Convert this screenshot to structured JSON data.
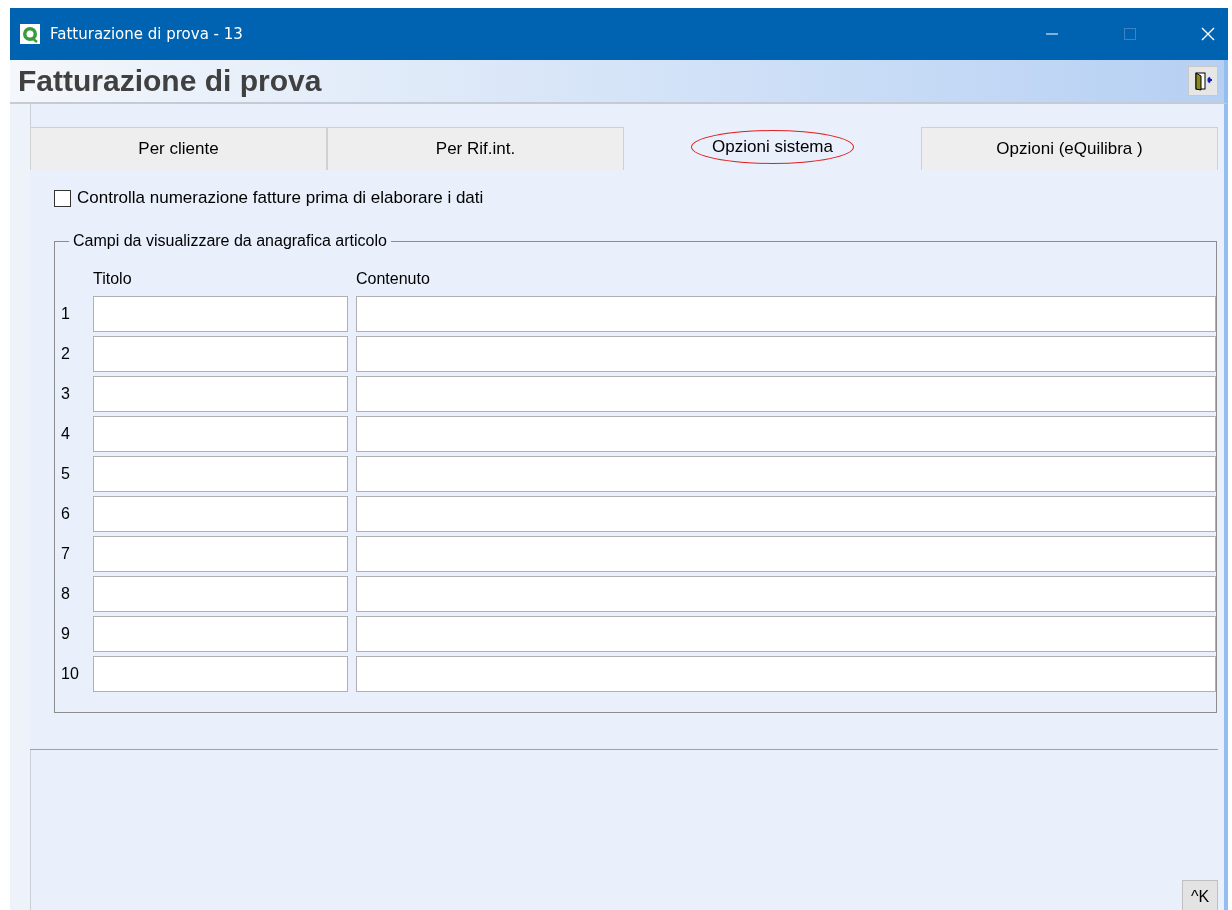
{
  "window": {
    "title": "Fatturazione di prova - 13"
  },
  "header": {
    "title": "Fatturazione di prova"
  },
  "tabs": [
    {
      "label": "Per cliente",
      "selected": false,
      "highlighted": false
    },
    {
      "label": "Per Rif.int.",
      "selected": false,
      "highlighted": false
    },
    {
      "label": "Opzioni sistema",
      "selected": true,
      "highlighted": true
    },
    {
      "label": "Opzioni (eQuilibra )",
      "selected": false,
      "highlighted": false
    }
  ],
  "check_numbering": {
    "label": "Controlla numerazione fatture prima di elaborare i dati",
    "checked": false
  },
  "fields_group": {
    "title": "Campi da visualizzare da anagrafica articolo",
    "columns": [
      "Titolo",
      "Contenuto"
    ],
    "rows": [
      {
        "number": "1"
      },
      {
        "number": "2"
      },
      {
        "number": "3"
      },
      {
        "number": "4"
      },
      {
        "number": "5"
      },
      {
        "number": "6"
      },
      {
        "number": "7"
      },
      {
        "number": "8"
      },
      {
        "number": "9"
      },
      {
        "number": "10"
      }
    ]
  },
  "shortcut_button": {
    "label": "^K"
  }
}
